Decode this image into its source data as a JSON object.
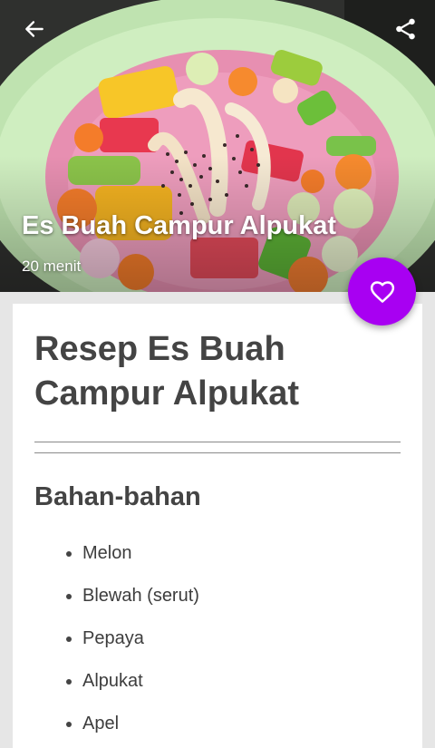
{
  "hero": {
    "title": "Es Buah Campur Alpukat",
    "duration": "20 menit",
    "image_alt": "Es Buah Campur Alpukat"
  },
  "toolbar": {
    "back_icon": "arrow-left-icon",
    "share_icon": "share-icon"
  },
  "fab": {
    "icon": "heart-outline-icon",
    "color": "#a800f2"
  },
  "recipe": {
    "title": "Resep Es Buah Campur Alpukat",
    "ingredients_heading": "Bahan-bahan",
    "ingredients": [
      "Melon",
      "Blewah (serut)",
      "Pepaya",
      "Alpukat",
      "Apel"
    ]
  },
  "colors": {
    "accent": "#a800f2",
    "text_dark": "#444444",
    "page_bg": "#e6e6e6",
    "card_bg": "#ffffff"
  }
}
